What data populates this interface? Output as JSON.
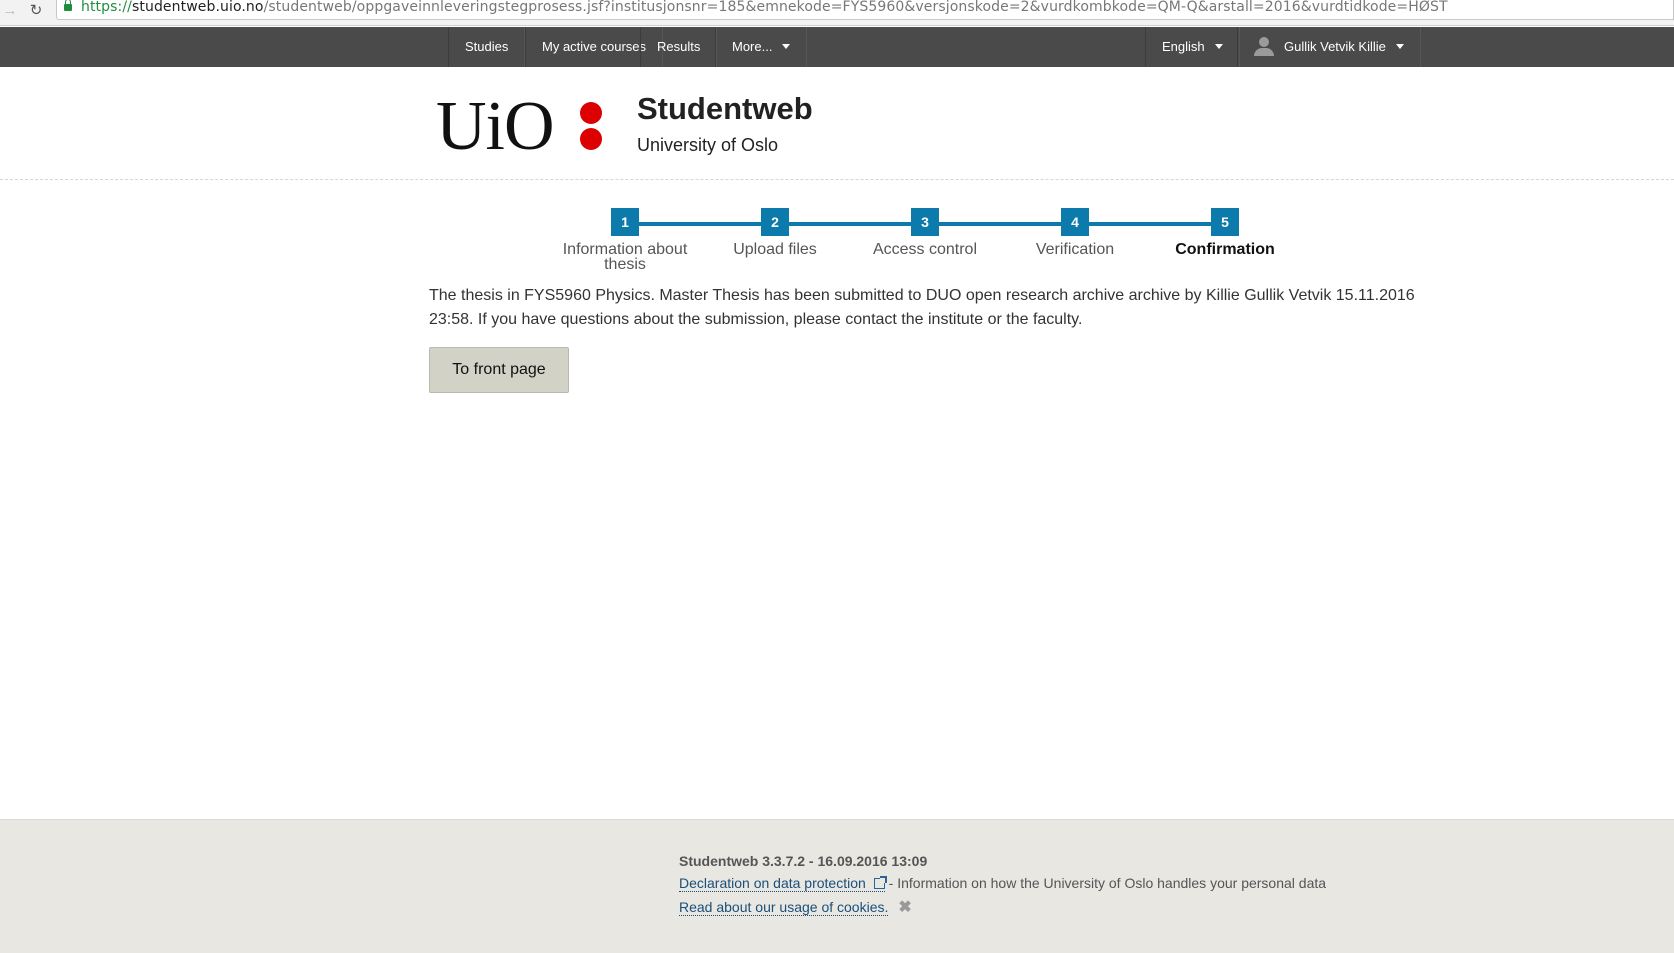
{
  "browser": {
    "url_proto": "https://",
    "url_host": "studentweb.uio.no",
    "url_path": "/studentweb/oppgaveinnleveringstegprosess.jsf?institusjonsnr=185&emnekode=FYS5960&versjonskode=2&vurdkombkode=QM-Q&arstall=2016&vurdtidkode=HØST"
  },
  "nav": {
    "studies": "Studies",
    "active_courses": "My active courses",
    "results": "Results",
    "more": "More...",
    "language": "English",
    "user": "Gullik Vetvik Killie"
  },
  "header": {
    "logo_text": "UiO",
    "title": "Studentweb",
    "subtitle": "University of Oslo"
  },
  "steps": [
    {
      "num": "1",
      "label": "Information about thesis"
    },
    {
      "num": "2",
      "label": "Upload files"
    },
    {
      "num": "3",
      "label": "Access control"
    },
    {
      "num": "4",
      "label": "Verification"
    },
    {
      "num": "5",
      "label": "Confirmation"
    }
  ],
  "main": {
    "message": "The thesis in FYS5960 Physics. Master Thesis has been submitted to DUO open research archive archive by Killie Gullik Vetvik 15.11.2016 23:58. If you have questions about the submission, please contact the institute or the faculty.",
    "front_button": "To front page"
  },
  "footer": {
    "version": "Studentweb 3.3.7.2 - 16.09.2016 13:09",
    "privacy_link": "Declaration on data protection",
    "privacy_text": " - Information on how the University of Oslo handles your personal data",
    "cookies_link": "Read about our usage of cookies.",
    "close_symbol": "✖"
  },
  "colors": {
    "step_accent": "#0c7bab",
    "logo_red": "#dd0000",
    "nav_bg": "#4a4a4a"
  }
}
